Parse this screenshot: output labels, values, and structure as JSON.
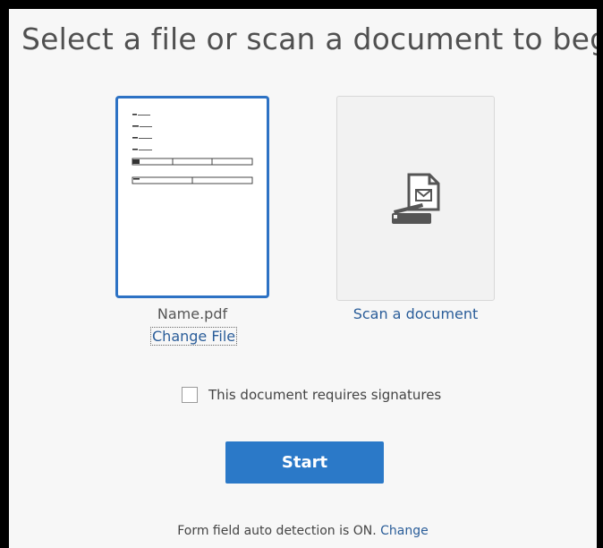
{
  "dialog": {
    "title": "Select a file or scan a document to begin"
  },
  "file": {
    "name": "Name.pdf",
    "change_label": "Change File"
  },
  "scan": {
    "label": "Scan a document",
    "icon": "scanner-icon"
  },
  "signatures": {
    "label": "This document requires signatures",
    "checked": false
  },
  "start_button": {
    "label": "Start"
  },
  "footer": {
    "text": "Form field auto detection is ON.",
    "link": "Change"
  },
  "colors": {
    "accent": "#2b79c8",
    "link": "#2a5d99",
    "selected_border": "#2d72c4"
  }
}
